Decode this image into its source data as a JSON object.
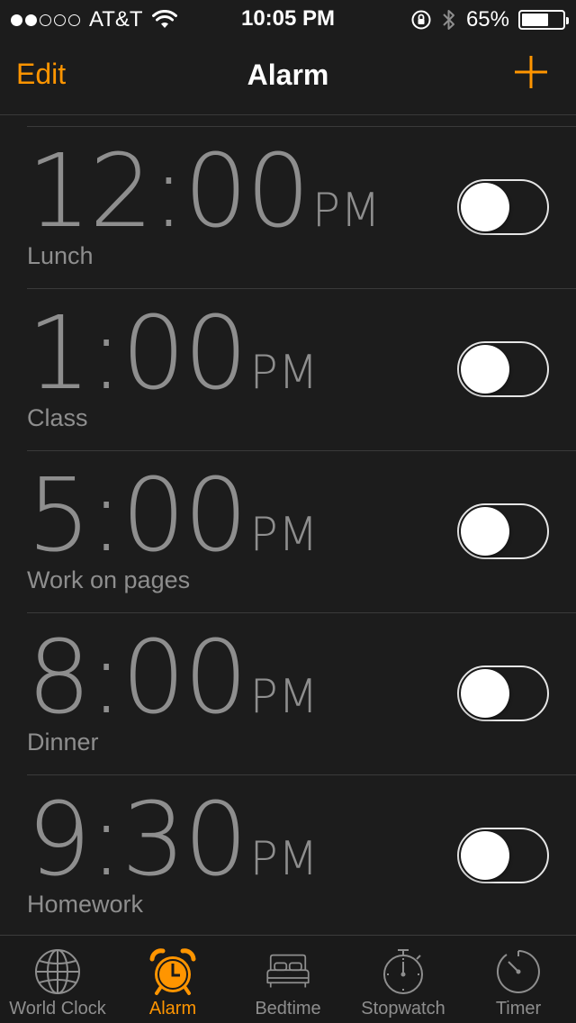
{
  "status_bar": {
    "signal_dots_filled": 2,
    "signal_dots_total": 5,
    "carrier": "AT&T",
    "time": "10:05 PM",
    "battery_percent": "65%",
    "battery_level": 0.65
  },
  "nav": {
    "edit_label": "Edit",
    "title": "Alarm",
    "add_icon": "plus-icon"
  },
  "alarms": [
    {
      "time": "12:00",
      "ampm": "PM",
      "label": "Lunch",
      "enabled": false
    },
    {
      "time": "1:00",
      "ampm": "PM",
      "label": "Class",
      "enabled": false
    },
    {
      "time": "5:00",
      "ampm": "PM",
      "label": "Work on pages",
      "enabled": false
    },
    {
      "time": "8:00",
      "ampm": "PM",
      "label": "Dinner",
      "enabled": false
    },
    {
      "time": "9:30",
      "ampm": "PM",
      "label": "Homework",
      "enabled": false
    }
  ],
  "tabs": [
    {
      "label": "World Clock",
      "icon": "globe-icon",
      "active": false
    },
    {
      "label": "Alarm",
      "icon": "alarm-clock-icon",
      "active": true
    },
    {
      "label": "Bedtime",
      "icon": "bed-icon",
      "active": false
    },
    {
      "label": "Stopwatch",
      "icon": "stopwatch-icon",
      "active": false
    },
    {
      "label": "Timer",
      "icon": "timer-icon",
      "active": false
    }
  ],
  "colors": {
    "accent": "#ff9500",
    "background": "#1c1c1c",
    "text_secondary": "#8e8e8e"
  }
}
